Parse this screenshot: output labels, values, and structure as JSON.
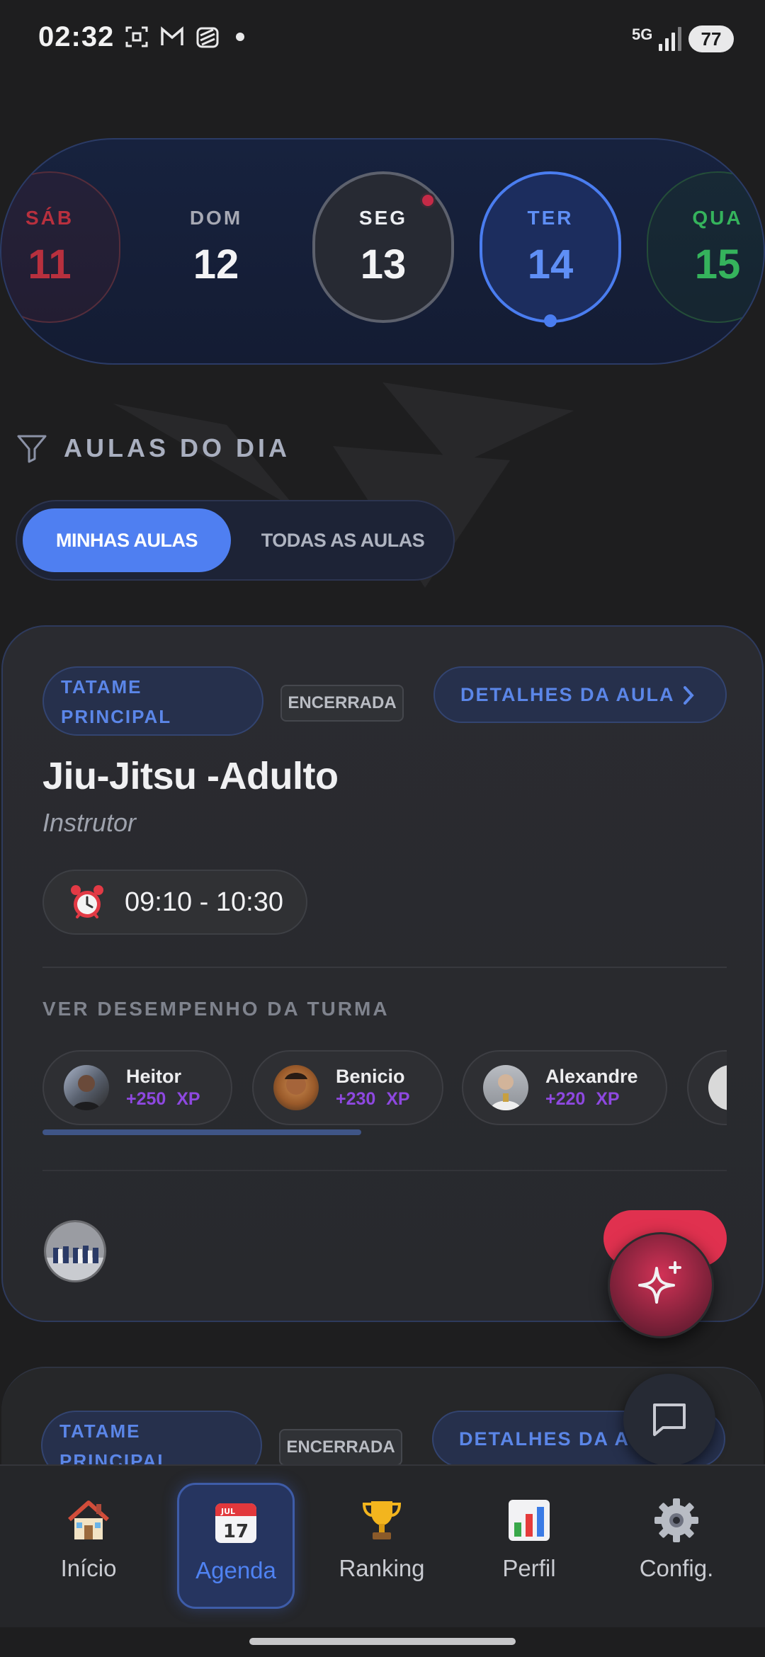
{
  "status_bar": {
    "time": "02:32",
    "network": "5G",
    "battery": "77"
  },
  "days": [
    {
      "name": "SÁB",
      "num": "11",
      "color": "#b8303e"
    },
    {
      "name": "DOM",
      "num": "12",
      "color": "#f3f3f5"
    },
    {
      "name": "SEG",
      "num": "13",
      "color": "#f3f3f5",
      "has_event": true
    },
    {
      "name": "TER",
      "num": "14",
      "color": "#5f8ff6",
      "selected": true
    },
    {
      "name": "QUA",
      "num": "15",
      "color": "#35b35c"
    }
  ],
  "section": {
    "title": "AULAS DO DIA"
  },
  "toggle": {
    "mine": "MINHAS AULAS",
    "all": "TODAS AS AULAS",
    "selected": "mine"
  },
  "class_card": {
    "location": "TATAME PRINCIPAL",
    "status": "ENCERRADA",
    "details_label": "DETALHES DA AULA",
    "title": "Jiu-Jitsu -Adulto",
    "instructor": "Instrutor",
    "time": "09:10 - 10:30",
    "performance_label": "VER DESEMPENHO DA TURMA",
    "ranking": [
      {
        "name": "Heitor",
        "xp": "+250  XP"
      },
      {
        "name": "Benicio",
        "xp": "+230  XP"
      },
      {
        "name": "Alexandre",
        "xp": "+220  XP"
      }
    ]
  },
  "class_card_2": {
    "location": "TATAME PRINCIPAL",
    "status": "ENCERRADA",
    "details_label": "DETALHES DA AU"
  },
  "nav": {
    "items": [
      {
        "label": "Início",
        "icon": "house-icon"
      },
      {
        "label": "Agenda",
        "icon": "calendar-icon",
        "active": true,
        "calendar_month": "JUL",
        "calendar_day": "17"
      },
      {
        "label": "Ranking",
        "icon": "trophy-icon"
      },
      {
        "label": "Perfil",
        "icon": "bar-chart-icon"
      },
      {
        "label": "Config.",
        "icon": "gear-icon"
      }
    ]
  },
  "colors": {
    "accent": "#4f7ff1",
    "danger": "#e0314f",
    "xp": "#8e48e0"
  }
}
